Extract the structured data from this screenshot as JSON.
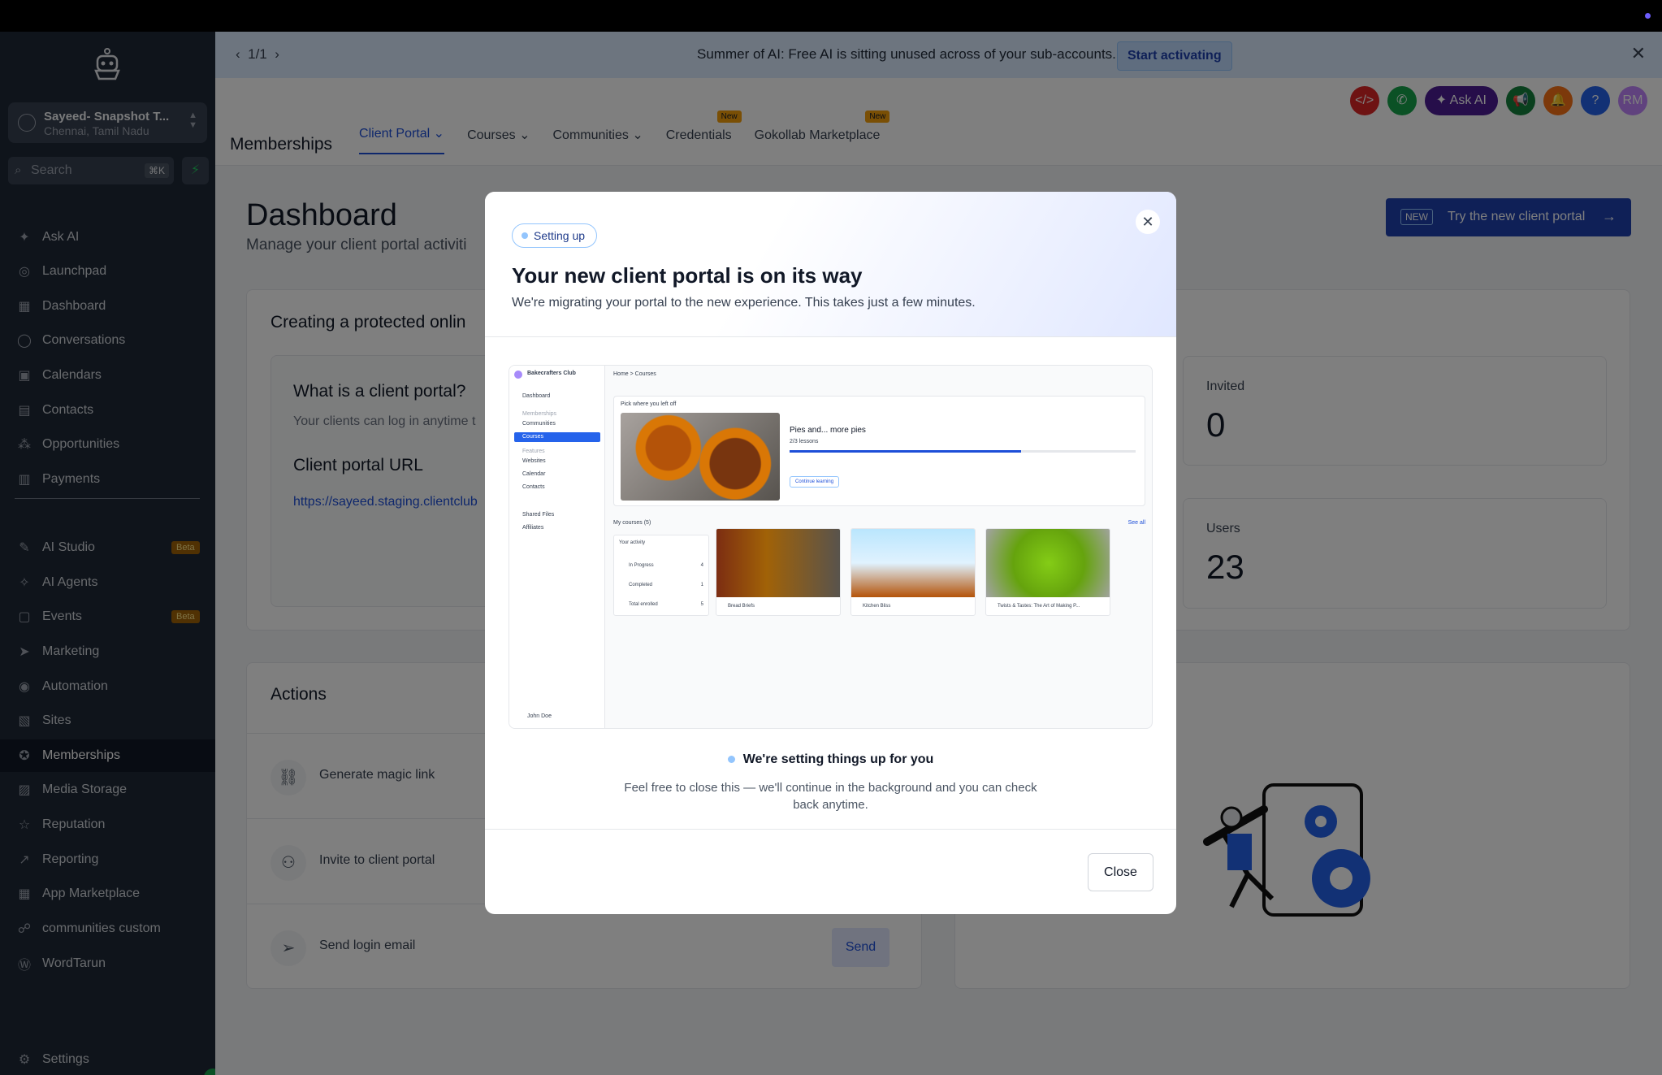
{
  "sidebar": {
    "account": {
      "name": "Sayeed- Snapshot T...",
      "location": "Chennai, Tamil Nadu"
    },
    "search": {
      "placeholder": "Search",
      "shortcut": "⌘K"
    },
    "items": [
      {
        "label": "Ask AI",
        "icon": "sparkle-icon"
      },
      {
        "label": "Launchpad",
        "icon": "rocket-icon"
      },
      {
        "label": "Dashboard",
        "icon": "grid-icon"
      },
      {
        "label": "Conversations",
        "icon": "chat-icon"
      },
      {
        "label": "Calendars",
        "icon": "calendar-icon"
      },
      {
        "label": "Contacts",
        "icon": "contacts-icon"
      },
      {
        "label": "Opportunities",
        "icon": "pipeline-icon"
      },
      {
        "label": "Payments",
        "icon": "receipt-icon"
      },
      {
        "label": "AI Studio",
        "icon": "ai-studio-icon",
        "badge": "Beta"
      },
      {
        "label": "AI Agents",
        "icon": "agent-icon"
      },
      {
        "label": "Events",
        "icon": "events-icon",
        "badge": "Beta"
      },
      {
        "label": "Marketing",
        "icon": "send-icon"
      },
      {
        "label": "Automation",
        "icon": "automation-icon"
      },
      {
        "label": "Sites",
        "icon": "sites-icon"
      },
      {
        "label": "Memberships",
        "icon": "membership-icon",
        "active": true
      },
      {
        "label": "Media Storage",
        "icon": "image-icon"
      },
      {
        "label": "Reputation",
        "icon": "star-icon"
      },
      {
        "label": "Reporting",
        "icon": "chart-icon"
      },
      {
        "label": "App Marketplace",
        "icon": "apps-icon"
      },
      {
        "label": "communities custom",
        "icon": "community-icon"
      },
      {
        "label": "WordTarun",
        "icon": "wordpress-icon"
      }
    ],
    "settings": "Settings"
  },
  "banner": {
    "pager": "1/1",
    "message": "Summer of AI: Free AI is sitting unused across of your sub-accounts.",
    "cta": "Start activating"
  },
  "header": {
    "ask_ai": "Ask AI",
    "avatar": "RM",
    "app_title": "Memberships",
    "tabs": [
      {
        "label": "Client Portal",
        "active": true,
        "dropdown": true
      },
      {
        "label": "Courses",
        "dropdown": true
      },
      {
        "label": "Communities",
        "dropdown": true
      },
      {
        "label": "Credentials",
        "new": "New"
      },
      {
        "label": "Gokollab Marketplace",
        "new": "New"
      }
    ]
  },
  "dashboard": {
    "title": "Dashboard",
    "subtitle": "Manage your client portal activiti",
    "try_badge": "NEW",
    "try_label": "Try the new client portal",
    "protected_title": "Creating a protected onlin",
    "what_title": "What is a client portal?",
    "what_desc": "Your clients can log in anytime t",
    "url_title": "Client portal URL",
    "url": "https://sayeed.staging.clientclub",
    "stats": [
      {
        "label": "Invited",
        "value": "0"
      },
      {
        "label": "Users",
        "value": "23"
      }
    ],
    "actions_title": "Actions",
    "actions": [
      {
        "label": "Generate magic link",
        "icon": "link-icon"
      },
      {
        "label": "Invite to client portal",
        "icon": "user-plus-icon"
      },
      {
        "label": "Send login email",
        "icon": "paper-plane-icon"
      }
    ],
    "send_label": "Send"
  },
  "modal": {
    "pill": "Setting up",
    "title": "Your new client portal is on its way",
    "subtitle": "We're migrating your portal to the new experience. This takes just a few minutes.",
    "status": "We're setting things up for you",
    "description": "Feel free to close this — we'll continue in the background and you can check back anytime.",
    "close_label": "Close",
    "preview": {
      "club_name": "Bakecrafters Club",
      "breadcrumb": "Home  >  Courses",
      "side": [
        "Dashboard",
        "Memberships",
        "Communities",
        "Courses",
        "Features",
        "Websites",
        "Calendar",
        "Contacts",
        "Shared Files",
        "Affiliates"
      ],
      "resume_label": "Pick where you left off",
      "course_title": "Pies and... more pies",
      "lessons": "2/3 lessons",
      "continue": "Continue learning",
      "my_courses": "My courses (5)",
      "see_all": "See all",
      "activity_title": "Your activity",
      "activity": [
        {
          "label": "In Progress",
          "value": "4"
        },
        {
          "label": "Completed",
          "value": "1"
        },
        {
          "label": "Total enrolled",
          "value": "5"
        }
      ],
      "courses": [
        "Bread Briefs",
        "Kitchen Bliss",
        "Twists & Tastes: The Art of Making P..."
      ],
      "user": "John Doe"
    }
  }
}
